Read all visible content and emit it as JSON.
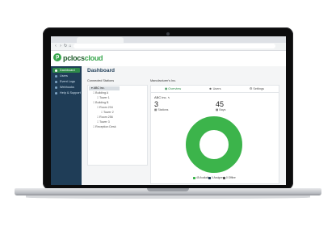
{
  "app": {
    "logo_mark": "p",
    "brand_a": "pclocs",
    "brand_b": "cloud",
    "accent_color": "#37a64c",
    "sidebar_color": "#1f3d57"
  },
  "sidebar": {
    "items": [
      {
        "label": "Dashboard",
        "icon": "dashboard-icon",
        "active": true
      },
      {
        "label": "Users",
        "icon": "users-icon"
      },
      {
        "label": "Event Logs",
        "icon": "list-icon"
      },
      {
        "label": "Webhooks",
        "icon": "webhook-icon"
      },
      {
        "label": "Help & Support",
        "icon": "help-icon"
      }
    ]
  },
  "main": {
    "title": "Dashboard",
    "stations_label": "Connected Stations",
    "tree": [
      {
        "label": "ABC inc.",
        "depth": 0,
        "selected": true
      },
      {
        "label": "Building A",
        "depth": 1
      },
      {
        "label": "Tower 1",
        "depth": 2
      },
      {
        "label": "Building B",
        "depth": 1
      },
      {
        "label": "Room 234",
        "depth": 2
      },
      {
        "label": "Tower 2",
        "depth": 3
      },
      {
        "label": "Room 256",
        "depth": 2
      },
      {
        "label": "Tower 3",
        "depth": 2
      },
      {
        "label": "Reception Desk",
        "depth": 1
      }
    ],
    "details_label": "Manufacturer's Inc.",
    "tabs": [
      {
        "label": "Overview",
        "active": true
      },
      {
        "label": "Users"
      },
      {
        "label": "Settings"
      }
    ],
    "entity_name": "ABC inc.",
    "stations_count": "3",
    "stations_count_label": "Stations",
    "bays_count": "45",
    "bays_count_label": "Bays",
    "chart_data": {
      "type": "pie",
      "donut": true,
      "title": "",
      "slices": [
        {
          "label": "45 Available",
          "value": 45,
          "color": "#3cb44b"
        },
        {
          "label": "0 Assigned",
          "value": 0,
          "color": "#1f3d57"
        },
        {
          "label": "0 Offline",
          "value": 0,
          "color": "#555555"
        }
      ],
      "legend": "bottom"
    }
  }
}
